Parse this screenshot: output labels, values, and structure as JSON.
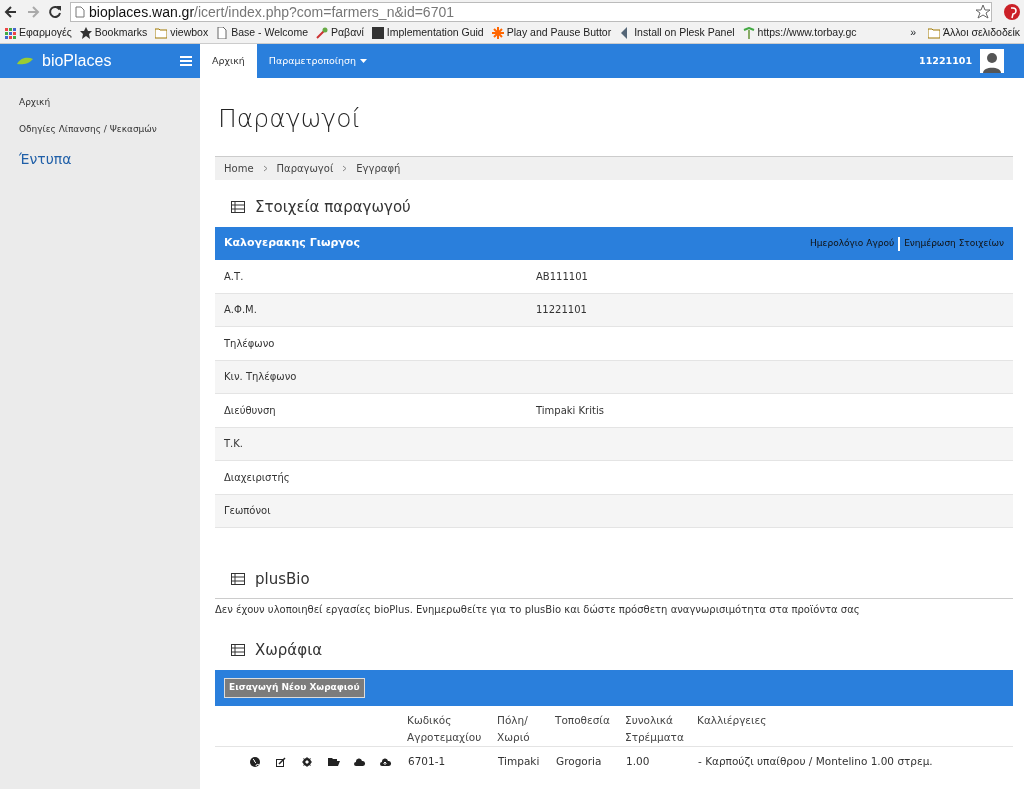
{
  "browser": {
    "url_host": "bioplaces.wan.gr",
    "url_path": "/icert/index.php?com=farmers_n&id=6701",
    "bookmarks": [
      {
        "label": "Εφαρμογές",
        "kind": "apps"
      },
      {
        "label": "Bookmarks",
        "kind": "star"
      },
      {
        "label": "viewbox",
        "kind": "folder"
      },
      {
        "label": "Base - Welcome",
        "kind": "page"
      },
      {
        "label": "Ραβανί",
        "kind": "tool"
      },
      {
        "label": "Implementation Guid",
        "kind": "dark"
      },
      {
        "label": "Play and Pause Buttor",
        "kind": "spark"
      },
      {
        "label": "Install on Plesk Panel",
        "kind": "plesk"
      },
      {
        "label": "https://www.torbay.gc",
        "kind": "palm"
      }
    ],
    "overflow": "»",
    "other_bookmarks": "Άλλοι σελιδοδείκ"
  },
  "navbar": {
    "brand": "bioPlaces",
    "tabs": [
      {
        "label": "Αρχική",
        "selected": true,
        "dropdown": false
      },
      {
        "label": "Παραμετροποίηση",
        "selected": false,
        "dropdown": true
      }
    ],
    "user": "11221101"
  },
  "sidebar": {
    "items": [
      {
        "label": "Αρχική",
        "kind": "link"
      },
      {
        "label": "Οδηγίες Λίπανσης / Ψεκασμών",
        "kind": "link"
      },
      {
        "label": "Έντυπα",
        "kind": "heading"
      }
    ]
  },
  "page_title": "Παραγωγοί",
  "breadcrumb": [
    "Home",
    "Παραγωγοί",
    "Εγγραφή"
  ],
  "producer": {
    "title": "Στοιχεία παραγωγού",
    "name": "Καλογερακης Γιωργος",
    "links": [
      "Ημερολόγιο Αγρού",
      "Ενημέρωση Στοιχείων"
    ],
    "fields": [
      {
        "label": "Α.Τ.",
        "value": "AB111101"
      },
      {
        "label": "Α.Φ.Μ.",
        "value": "11221101"
      },
      {
        "label": "Τηλέφωνο"
      },
      {
        "label": "Κιν. Τηλέφωνο"
      },
      {
        "label": "Διεύθυνση",
        "value": "Timpaki Kritis"
      },
      {
        "label": "Τ.Κ."
      },
      {
        "label": "Διαχειριστής"
      },
      {
        "label": "Γεωπόνοι"
      }
    ]
  },
  "plusbio": {
    "title": "plusBio",
    "message": "Δεν έχουν υλοποιηθεί εργασίες bioPlus. Ενημερωθείτε για το plusBio και δώστε πρόσθετη αναγνωρισιμότητα στα προϊόντα σας"
  },
  "fields_section": {
    "title": "Χωράφια",
    "add_button": "Εισαγωγή Νέου Χωραφιού",
    "columns": [
      "Κωδικός Αγροτεμαχίου",
      "Πόλη/ Χωριό",
      "Τοποθεσία",
      "Συνολικά Στρέμματα",
      "Καλλιέργειες"
    ],
    "rows": [
      {
        "cells": [
          "6701-1",
          "Timpaki",
          "Grogoria",
          "1.00",
          "- Καρπούζι υπαίθρου / Montelino 1.00 στρεμ."
        ]
      }
    ]
  }
}
